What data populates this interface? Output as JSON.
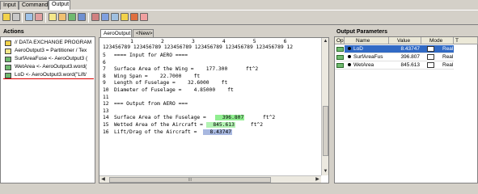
{
  "top_tabs": [
    "Input",
    "Command",
    "Output"
  ],
  "toolbar": {
    "icons": [
      "open-icon",
      "save-icon",
      "grid-icon",
      "calc-icon",
      "copy-icon",
      "paste-icon",
      "table-icon",
      "doc-icon",
      "network-icon",
      "refresh-icon",
      "sync-icon",
      "folder-icon",
      "export-icon",
      "clear-icon"
    ]
  },
  "actions": {
    "title": "Actions",
    "items": [
      {
        "label": "// DATA EXCHANGE PROGRAM",
        "icon": "folder-icon",
        "color": "#f2d24a"
      },
      {
        "label": "AeroOutput3 = Partitioner / Tex",
        "icon": "partitioner-icon",
        "color": "#f5e88a"
      },
      {
        "label": "SurfAreaFuse <- AeroOutput3 (",
        "icon": "link-icon",
        "color": "#6fb96f"
      },
      {
        "label": "WetArea <- AeroOutput3.word(",
        "icon": "link-icon",
        "color": "#6fb96f"
      },
      {
        "label": "LoD <- AeroOutput3.word(\"Lift/",
        "icon": "link-icon",
        "color": "#6fb96f"
      }
    ]
  },
  "editor": {
    "tabs": [
      "AeroOutput",
      "<New>"
    ],
    "ruler_numbers": "         1         2         3         4         5         6",
    "ruler_digits": "123456789 123456789 123456789 123456789 123456789 123456789 12",
    "lines": [
      {
        "num": "5",
        "text": "==== Input for AERO ===="
      },
      {
        "num": "6",
        "text": ""
      },
      {
        "num": "7",
        "text": "Surface Area of the Wing =    177.300      ft^2"
      },
      {
        "num": "8",
        "text": "Wing Span =    22.7000    ft"
      },
      {
        "num": "9",
        "text": "Length of Fuselage =    32.6000    ft"
      },
      {
        "num": "10",
        "text": "Diameter of Fuselage =    4.85000    ft"
      },
      {
        "num": "11",
        "text": ""
      },
      {
        "num": "12",
        "text": "=== Output from AERO ==="
      },
      {
        "num": "13",
        "text": ""
      },
      {
        "num": "14",
        "pre": "Surface Area of the Fuselage =   ",
        "hl": "  396.807",
        "post": "      ft^2",
        "hl_color": "#90ee90"
      },
      {
        "num": "15",
        "pre": "Wetted Area of the Aircraft = ",
        "hl": "  845.613",
        "post": "     ft^2",
        "hl_color": "#b2f2b2"
      },
      {
        "num": "16",
        "pre": "Lift/Drag of the Aircraft =  ",
        "hl": "  8.43747",
        "post": "",
        "hl_color": "#a8b8e0"
      }
    ],
    "hscroll_label": "III"
  },
  "output_params": {
    "title": "Output Parameters",
    "columns": [
      "Op",
      "Name",
      "Value",
      "Mode",
      "T"
    ],
    "rows": [
      {
        "name": "LoD",
        "value": "8.43747",
        "mode": "Real",
        "selected": true
      },
      {
        "name": "SurfAreaFus",
        "value": "396.807",
        "mode": "Real",
        "selected": false
      },
      {
        "name": "WetArea",
        "value": "845.613",
        "mode": "Real",
        "selected": false
      }
    ]
  }
}
